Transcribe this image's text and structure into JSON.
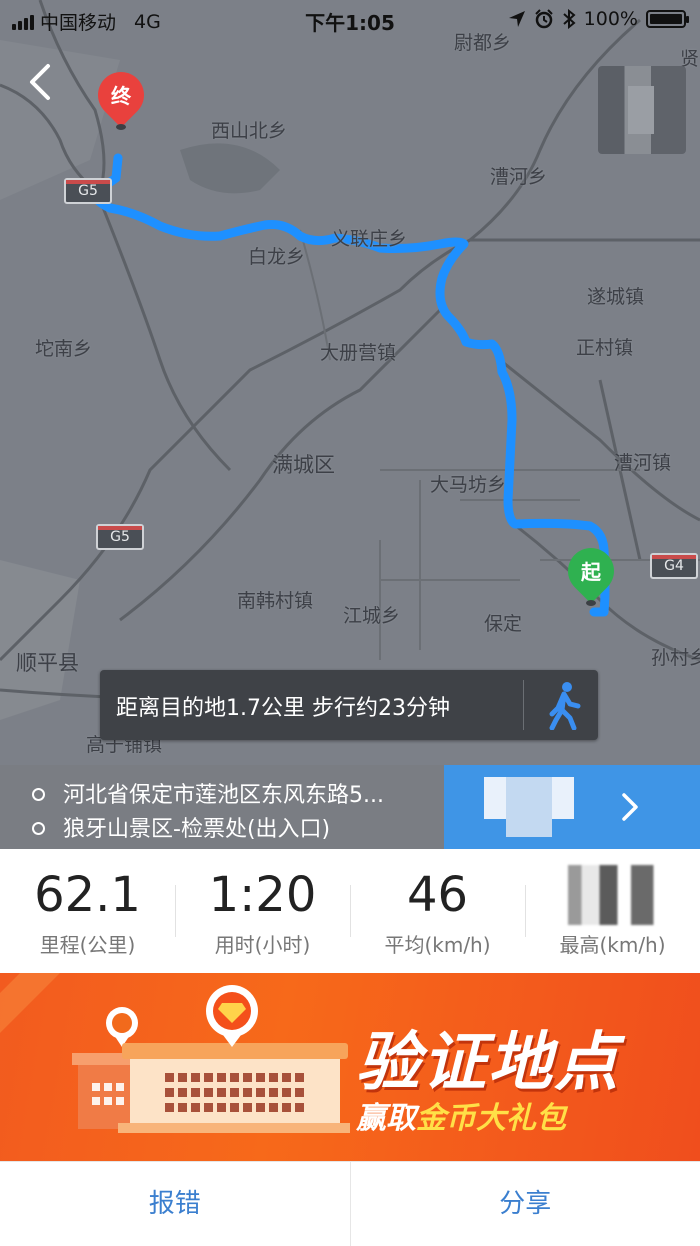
{
  "status_bar": {
    "carrier": "中国移动",
    "network": "4G",
    "time": "下午1:05",
    "battery": "100%"
  },
  "map": {
    "place_labels": [
      {
        "id": "weidu",
        "text": "尉都乡"
      },
      {
        "id": "xishanbei",
        "text": "西山北乡"
      },
      {
        "id": "laohe",
        "text": "漕河乡"
      },
      {
        "id": "yilianzhuang",
        "text": "义联庄乡"
      },
      {
        "id": "bailong",
        "text": "白龙乡"
      },
      {
        "id": "suicheng",
        "text": "遂城镇"
      },
      {
        "id": "tuonan",
        "text": "坨南乡"
      },
      {
        "id": "dacezying",
        "text": "大册营镇"
      },
      {
        "id": "zhengcun",
        "text": "正村镇"
      },
      {
        "id": "mancheng",
        "text": "满城区"
      },
      {
        "id": "damafang",
        "text": "大马坊乡"
      },
      {
        "id": "caohe",
        "text": "漕河镇"
      },
      {
        "id": "nanhancun",
        "text": "南韩村镇"
      },
      {
        "id": "jiangcheng",
        "text": "江城乡"
      },
      {
        "id": "baoding",
        "text": "保定"
      },
      {
        "id": "shunping",
        "text": "顺平县"
      },
      {
        "id": "suncun",
        "text": "孙村乡"
      },
      {
        "id": "gaoyu",
        "text": "高于铺镇"
      },
      {
        "id": "xian",
        "text": "贤"
      }
    ],
    "highway_shields": [
      {
        "id": "g5-top",
        "text": "G5"
      },
      {
        "id": "g5-mid",
        "text": "G5"
      },
      {
        "id": "g4",
        "text": "G4"
      }
    ],
    "end_marker_label": "终",
    "start_marker_label": "起",
    "route_color": "#1e90ff",
    "info_text": "距离目的地1.7公里 步行约23分钟"
  },
  "addresses": {
    "origin": "河北省保定市莲池区东风东路5...",
    "destination": "狼牙山景区-检票处(出入口)"
  },
  "stats": [
    {
      "value": "62.1",
      "label": "里程(公里)"
    },
    {
      "value": "1:20",
      "label": "用时(小时)"
    },
    {
      "value": "46",
      "label": "平均(km/h)"
    },
    {
      "value": "",
      "label": "最高(km/h)"
    }
  ],
  "banner": {
    "title": "验证地点",
    "subtitle_prefix": "赢取",
    "subtitle_highlight": "金币大礼包"
  },
  "bottom_bar": {
    "report": "报错",
    "share": "分享"
  }
}
